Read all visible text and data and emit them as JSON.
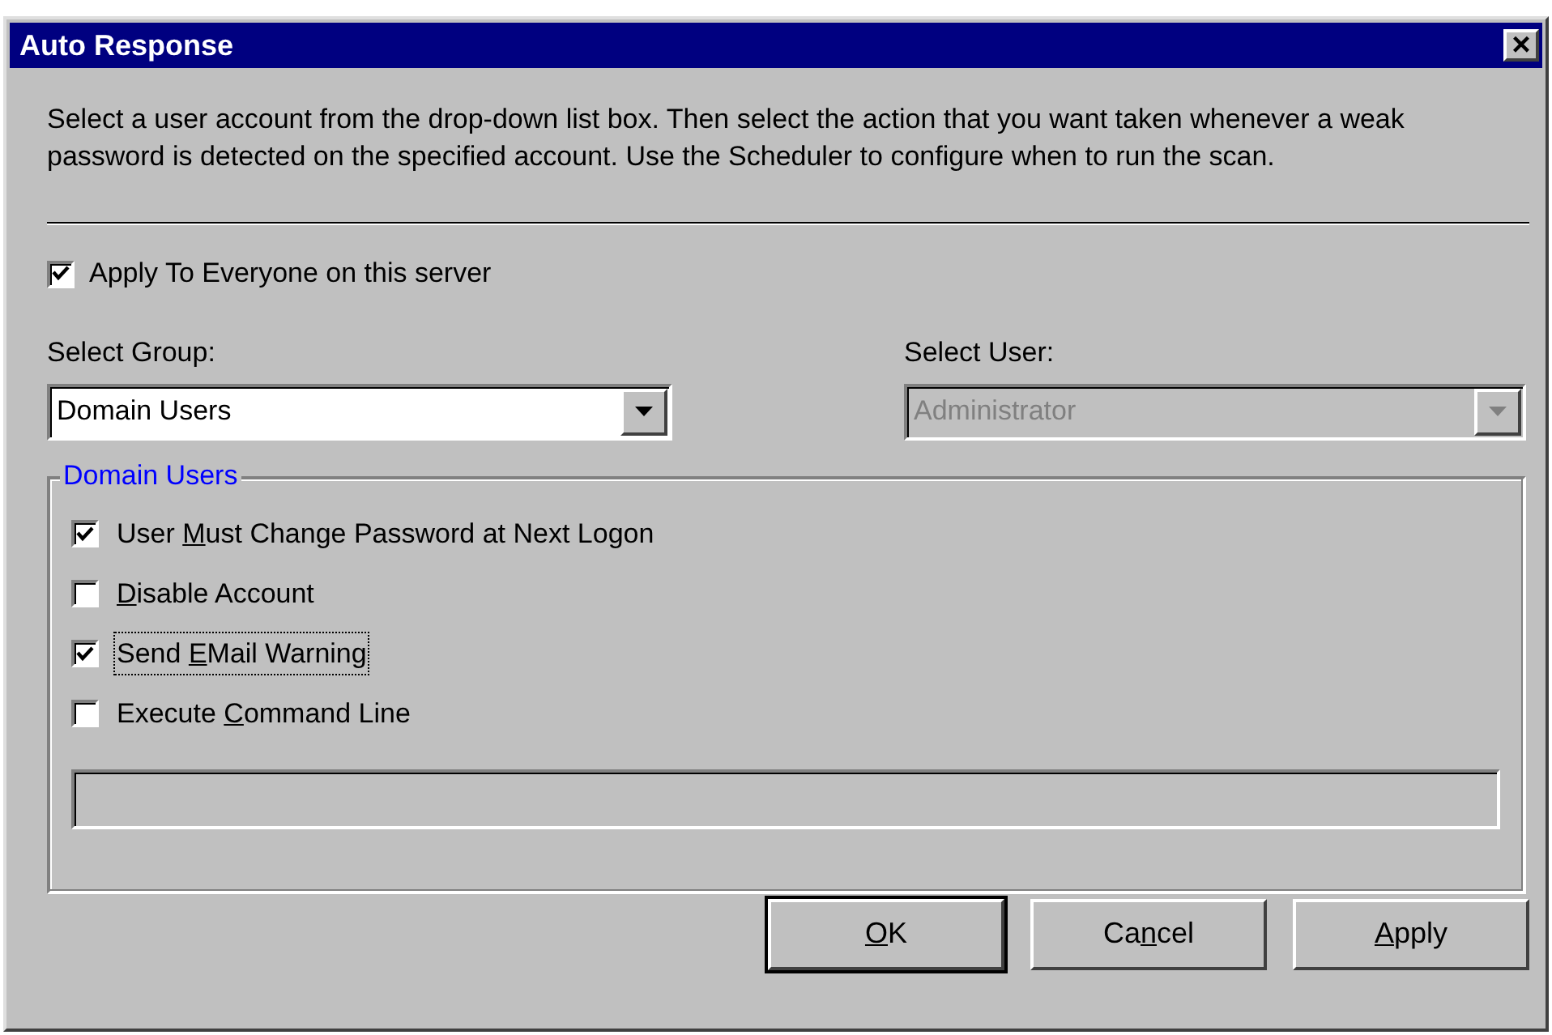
{
  "window": {
    "title": "Auto Response",
    "close": "×"
  },
  "description": "Select a user account from the drop-down list box. Then select the action that you want taken whenever a weak password is detected on the specified account. Use the Scheduler to configure when to run the scan.",
  "apply_to_everyone": {
    "label": "Apply To Everyone on this server",
    "checked": true
  },
  "select_group": {
    "label": "Select Group:",
    "value": "Domain Users",
    "disabled": false
  },
  "select_user": {
    "label": "Select User:",
    "value": "Administrator",
    "disabled": true
  },
  "group_box": {
    "title": "Domain Users",
    "options": [
      {
        "label": [
          {
            "text": "User "
          },
          {
            "text": "M",
            "underlined": true
          },
          {
            "text": "ust Change Password at Next Logon"
          }
        ],
        "checked": true,
        "focused": false
      },
      {
        "label": [
          {
            "text": "D",
            "underlined": true
          },
          {
            "text": "isable Account"
          }
        ],
        "checked": false,
        "focused": false
      },
      {
        "label": [
          {
            "text": "Send "
          },
          {
            "text": "E",
            "underlined": true
          },
          {
            "text": "Mail Warning"
          }
        ],
        "checked": true,
        "focused": true
      },
      {
        "label": [
          {
            "text": "Execute "
          },
          {
            "text": "C",
            "underlined": true
          },
          {
            "text": "ommand Line"
          }
        ],
        "checked": false,
        "focused": false
      }
    ],
    "command_line": {
      "disabled": true
    }
  },
  "buttons": [
    {
      "label": [
        {
          "text": "O",
          "underlined": true
        },
        {
          "text": "K"
        }
      ],
      "default": true
    },
    {
      "label": [
        {
          "text": "Ca"
        },
        {
          "text": "n",
          "underlined": true
        },
        {
          "text": "cel"
        }
      ],
      "default": false
    },
    {
      "label": [
        {
          "text": "A",
          "underlined": true
        },
        {
          "text": "pply"
        }
      ],
      "default": false
    }
  ]
}
